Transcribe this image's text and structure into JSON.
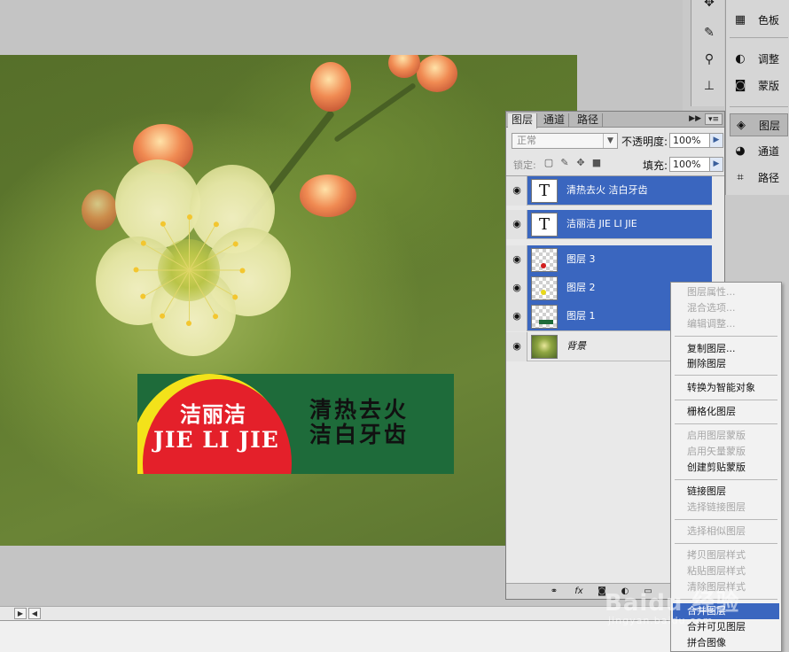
{
  "dock": {
    "icon_strip": [
      {
        "icon": "move-tool-icon"
      },
      {
        "icon": "brush-tool-icon"
      },
      {
        "icon": "clone-stamp-tool-icon"
      },
      {
        "icon": "history-brush-icon"
      }
    ],
    "items": [
      {
        "label": "色板",
        "icon": "swatches-icon"
      },
      {
        "label": "调整",
        "icon": "adjustments-icon"
      },
      {
        "label": "蒙版",
        "icon": "masks-icon"
      },
      {
        "label": "图层",
        "icon": "layers-icon"
      },
      {
        "label": "通道",
        "icon": "channels-icon"
      },
      {
        "label": "路径",
        "icon": "paths-icon"
      }
    ]
  },
  "canvas": {
    "brand_cn": "洁丽洁",
    "brand_en": "JIE LI JIE",
    "slogan_line1": "清热去火",
    "slogan_line2": "洁白牙齿",
    "banner_green": "#1e6b3a",
    "banner_red": "#e4202a",
    "banner_yellow": "#f3e21a"
  },
  "layers_panel": {
    "tabs": [
      "图层",
      "通道",
      "路径"
    ],
    "active_tab": "图层",
    "blend_mode": "正常",
    "opacity_label": "不透明度:",
    "opacity_value": "100%",
    "lock_label": "锁定:",
    "fill_label": "填充:",
    "fill_value": "100%",
    "layers": [
      {
        "name": "清热去火 洁白牙齿",
        "type": "text",
        "selected": true
      },
      {
        "name": "洁丽洁 JIE LI JIE",
        "type": "text",
        "selected": true
      },
      {
        "name": "图层 3",
        "type": "pixel",
        "selected": true
      },
      {
        "name": "图层 2",
        "type": "pixel",
        "selected": true
      },
      {
        "name": "图层 1",
        "type": "pixel",
        "selected": true
      },
      {
        "name": "背景",
        "type": "background",
        "selected": false
      }
    ],
    "text_thumb_glyph": "T",
    "selection_color": "#3a66bf"
  },
  "context_menu": {
    "items": [
      {
        "label": "图层属性...",
        "disabled": true
      },
      {
        "label": "混合选项...",
        "disabled": true
      },
      {
        "label": "编辑调整...",
        "disabled": true
      },
      {
        "label": "复制图层...",
        "disabled": false
      },
      {
        "label": "删除图层",
        "disabled": false
      },
      {
        "label": "转换为智能对象",
        "disabled": false
      },
      {
        "label": "栅格化图层",
        "disabled": false
      },
      {
        "label": "启用图层蒙版",
        "disabled": true
      },
      {
        "label": "启用矢量蒙版",
        "disabled": true
      },
      {
        "label": "创建剪贴蒙版",
        "disabled": false
      },
      {
        "label": "链接图层",
        "disabled": false
      },
      {
        "label": "选择链接图层",
        "disabled": true
      },
      {
        "label": "选择相似图层",
        "disabled": true
      },
      {
        "label": "拷贝图层样式",
        "disabled": true
      },
      {
        "label": "粘贴图层样式",
        "disabled": true
      },
      {
        "label": "清除图层样式",
        "disabled": true
      },
      {
        "label": "合并图层",
        "disabled": false,
        "highlighted": true
      },
      {
        "label": "合并可见图层",
        "disabled": false
      },
      {
        "label": "拼合图像",
        "disabled": false
      }
    ]
  },
  "watermark": {
    "text": "Baidu 经验",
    "sub": "jingyan.baidu.com"
  }
}
